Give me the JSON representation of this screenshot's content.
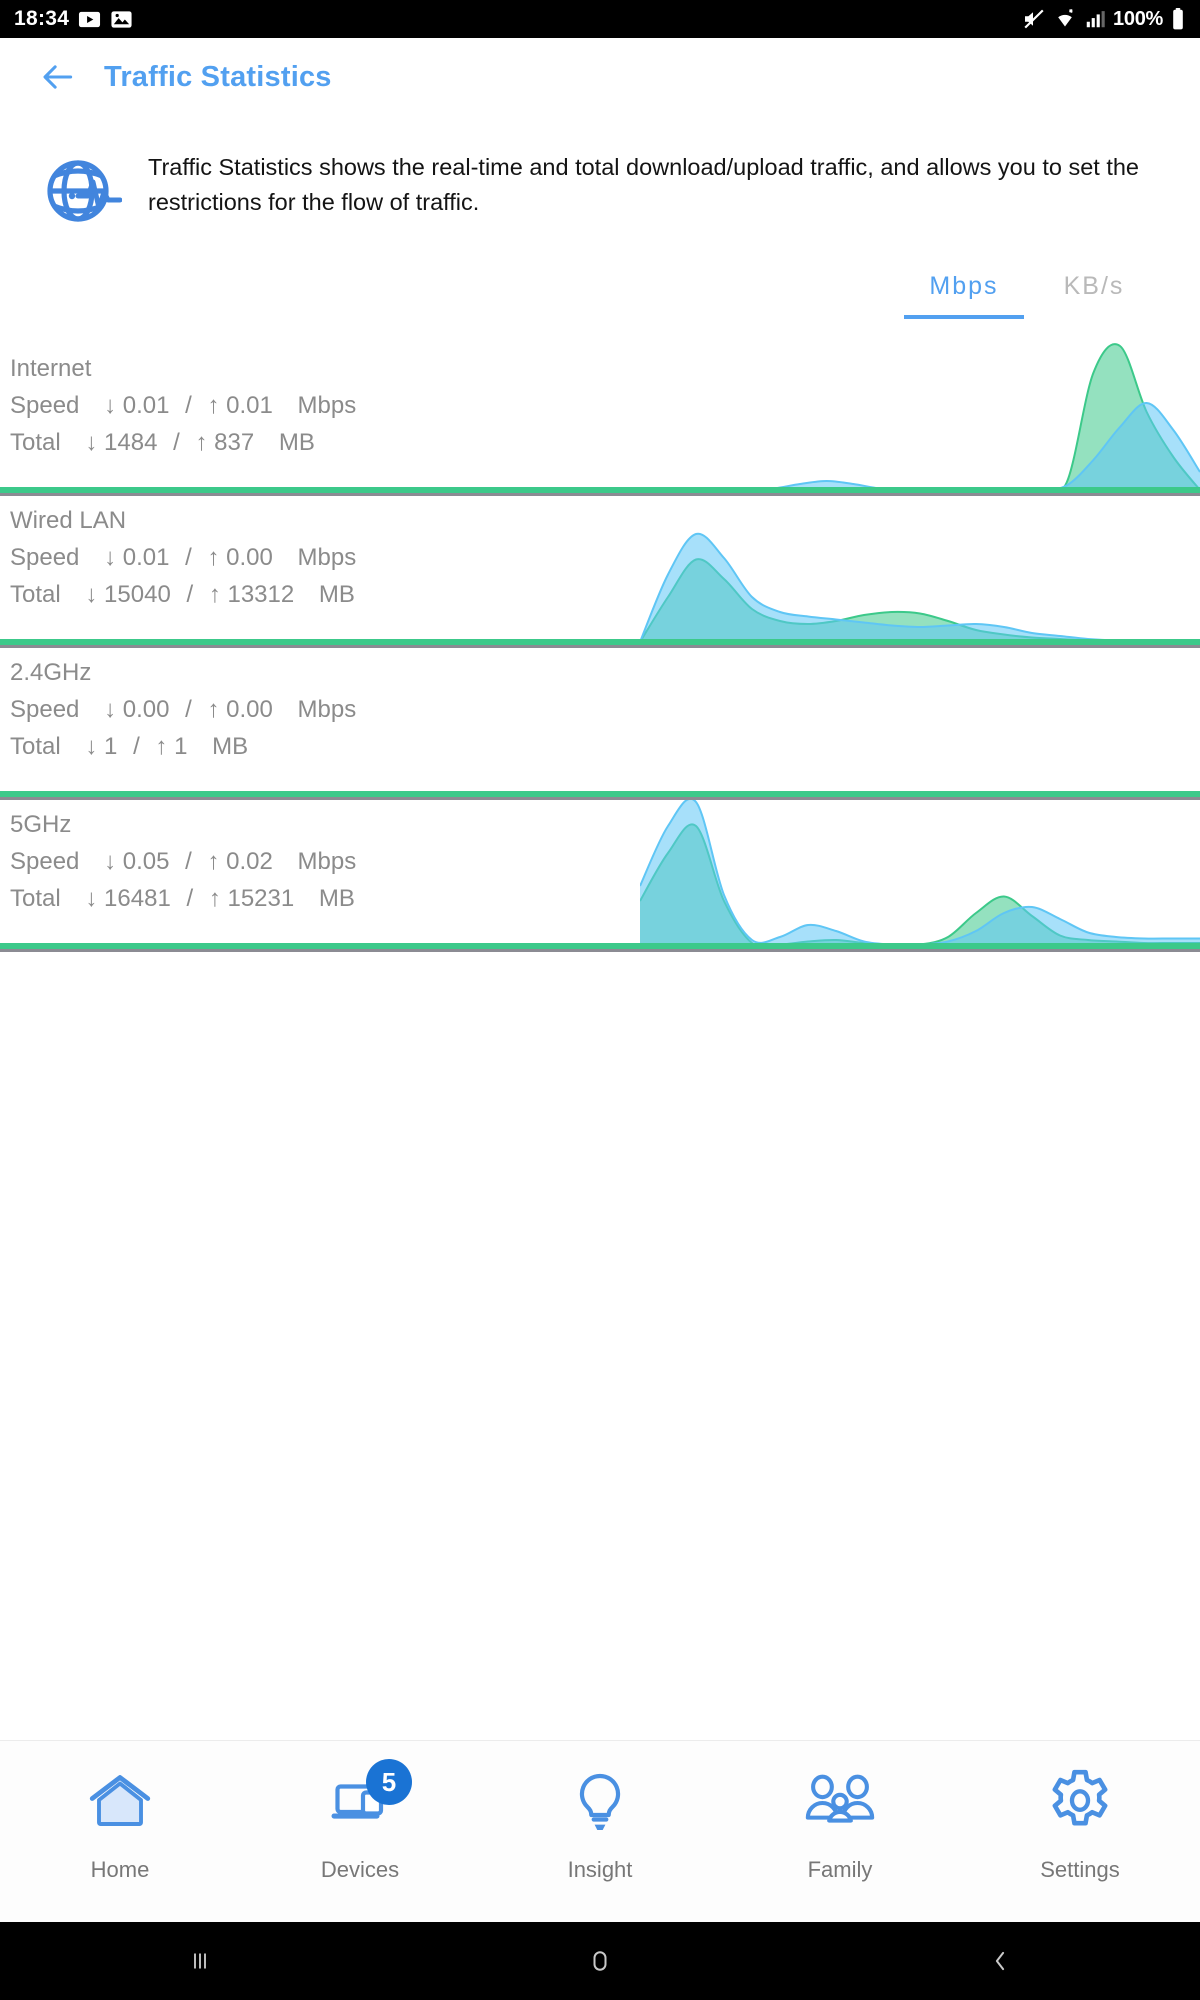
{
  "status_bar": {
    "time": "18:34",
    "battery_text": "100%",
    "icons": [
      "play-media-icon",
      "image-icon",
      "mute-icon",
      "wifi-icon",
      "cellular-signal-icon",
      "battery-icon"
    ]
  },
  "app_bar": {
    "back_label": "back-arrow-icon",
    "title": "Traffic Statistics"
  },
  "description": {
    "icon": "traffic-globe-pulse-icon",
    "text": "Traffic Statistics shows the real-time and total download/upload traffic, and allows you to set the restrictions for the flow of traffic."
  },
  "unit_tabs": {
    "active": "Mbps",
    "items": [
      {
        "label": "Mbps",
        "active": true
      },
      {
        "label": "KB/s",
        "active": false
      }
    ]
  },
  "colors": {
    "accent": "#52a0f0",
    "download_green": "#3cc98a",
    "upload_blue": "#5fc6f5",
    "baseline": "#3cc98a",
    "muted_text": "#8b8b8b",
    "badge": "#1a73d4"
  },
  "traffic_rows": [
    {
      "name": "Internet",
      "speed_label": "Speed",
      "speed_down": "0.01",
      "speed_up": "0.01",
      "speed_unit": "Mbps",
      "total_label": "Total",
      "total_down": "1484",
      "total_up": "837",
      "total_unit": "MB"
    },
    {
      "name": "Wired LAN",
      "speed_label": "Speed",
      "speed_down": "0.01",
      "speed_up": "0.00",
      "speed_unit": "Mbps",
      "total_label": "Total",
      "total_down": "15040",
      "total_up": "13312",
      "total_unit": "MB"
    },
    {
      "name": "2.4GHz",
      "speed_label": "Speed",
      "speed_down": "0.00",
      "speed_up": "0.00",
      "speed_unit": "Mbps",
      "total_label": "Total",
      "total_down": "1",
      "total_up": "1",
      "total_unit": "MB"
    },
    {
      "name": "5GHz",
      "speed_label": "Speed",
      "speed_down": "0.05",
      "speed_up": "0.02",
      "speed_unit": "Mbps",
      "total_label": "Total",
      "total_down": "16481",
      "total_up": "15231",
      "total_unit": "MB"
    }
  ],
  "chart_data": [
    {
      "type": "area",
      "title": "Internet",
      "xlabel": "",
      "ylabel": "",
      "grid": false,
      "legend": "none",
      "x": [
        0,
        5,
        10,
        15,
        20,
        25,
        30,
        35,
        40,
        45,
        50,
        55,
        60,
        65,
        70,
        75,
        80,
        85,
        90,
        95,
        100
      ],
      "ylim": [
        0,
        100
      ],
      "series": [
        {
          "name": "download",
          "color": "#3cc98a",
          "values": [
            0,
            0,
            0,
            0,
            0,
            0,
            0,
            0,
            0,
            0,
            0,
            0,
            0,
            0,
            0,
            0,
            5,
            78,
            96,
            52,
            22,
            0
          ]
        },
        {
          "name": "upload",
          "color": "#5fc6f5",
          "values": [
            0,
            0,
            0,
            0,
            0,
            1,
            4,
            6,
            4,
            1,
            0,
            0,
            0,
            0,
            0,
            0,
            3,
            20,
            42,
            58,
            40,
            12
          ]
        }
      ]
    },
    {
      "type": "area",
      "title": "Wired LAN",
      "xlabel": "",
      "ylabel": "",
      "grid": false,
      "legend": "none",
      "x": [
        0,
        5,
        10,
        15,
        20,
        25,
        30,
        35,
        40,
        45,
        50,
        55,
        60,
        65,
        70,
        75,
        80,
        85,
        90,
        95,
        100
      ],
      "ylim": [
        0,
        100
      ],
      "series": [
        {
          "name": "download",
          "color": "#3cc98a",
          "values": [
            0,
            30,
            55,
            42,
            22,
            14,
            12,
            14,
            18,
            20,
            19,
            14,
            8,
            5,
            3,
            2,
            1,
            1,
            0,
            0,
            0
          ]
        },
        {
          "name": "upload",
          "color": "#5fc6f5",
          "values": [
            0,
            45,
            72,
            56,
            30,
            20,
            17,
            15,
            13,
            11,
            10,
            11,
            12,
            10,
            6,
            4,
            2,
            1,
            1,
            0,
            0
          ]
        }
      ]
    },
    {
      "type": "area",
      "title": "2.4GHz",
      "xlabel": "",
      "ylabel": "",
      "grid": false,
      "legend": "none",
      "x": [
        0,
        5,
        10,
        15,
        20,
        25,
        30,
        35,
        40,
        45,
        50,
        55,
        60,
        65,
        70,
        75,
        80,
        85,
        90,
        95,
        100
      ],
      "ylim": [
        0,
        100
      ],
      "series": [
        {
          "name": "download",
          "color": "#3cc98a",
          "values": [
            0,
            0,
            0,
            0,
            0,
            0,
            0,
            0,
            0,
            0,
            0,
            0,
            0,
            0,
            0,
            0,
            0,
            0,
            0,
            0,
            0
          ]
        },
        {
          "name": "upload",
          "color": "#5fc6f5",
          "values": [
            0,
            0,
            0,
            0,
            0,
            0,
            0,
            0,
            0,
            0,
            0,
            0,
            0,
            0,
            0,
            0,
            0,
            0,
            0,
            0,
            0
          ]
        }
      ]
    },
    {
      "type": "area",
      "title": "5GHz",
      "xlabel": "",
      "ylabel": "",
      "grid": false,
      "legend": "none",
      "x": [
        0,
        5,
        10,
        15,
        20,
        25,
        30,
        35,
        40,
        45,
        50,
        55,
        60,
        65,
        70,
        75,
        80,
        85,
        90,
        95,
        100
      ],
      "ylim": [
        0,
        100
      ],
      "series": [
        {
          "name": "download",
          "color": "#3cc98a",
          "values": [
            30,
            62,
            80,
            30,
            2,
            1,
            3,
            4,
            2,
            1,
            1,
            6,
            22,
            33,
            20,
            7,
            4,
            3,
            2,
            2,
            2
          ]
        },
        {
          "name": "upload",
          "color": "#5fc6f5",
          "values": [
            40,
            80,
            96,
            34,
            4,
            6,
            14,
            10,
            3,
            1,
            1,
            3,
            10,
            22,
            26,
            18,
            9,
            6,
            5,
            5,
            5
          ]
        }
      ]
    }
  ],
  "bottom_nav": {
    "items": [
      {
        "label": "Home",
        "icon": "home-icon",
        "badge": null,
        "active": false
      },
      {
        "label": "Devices",
        "icon": "devices-laptop-icon",
        "badge": "5",
        "active": false
      },
      {
        "label": "Insight",
        "icon": "lightbulb-icon",
        "badge": null,
        "active": false
      },
      {
        "label": "Family",
        "icon": "family-people-icon",
        "badge": null,
        "active": false
      },
      {
        "label": "Settings",
        "icon": "gear-icon",
        "badge": null,
        "active": false
      }
    ]
  },
  "android_nav": {
    "recents": "recents-icon",
    "home": "home-circle-icon",
    "back": "back-chevron-icon"
  }
}
